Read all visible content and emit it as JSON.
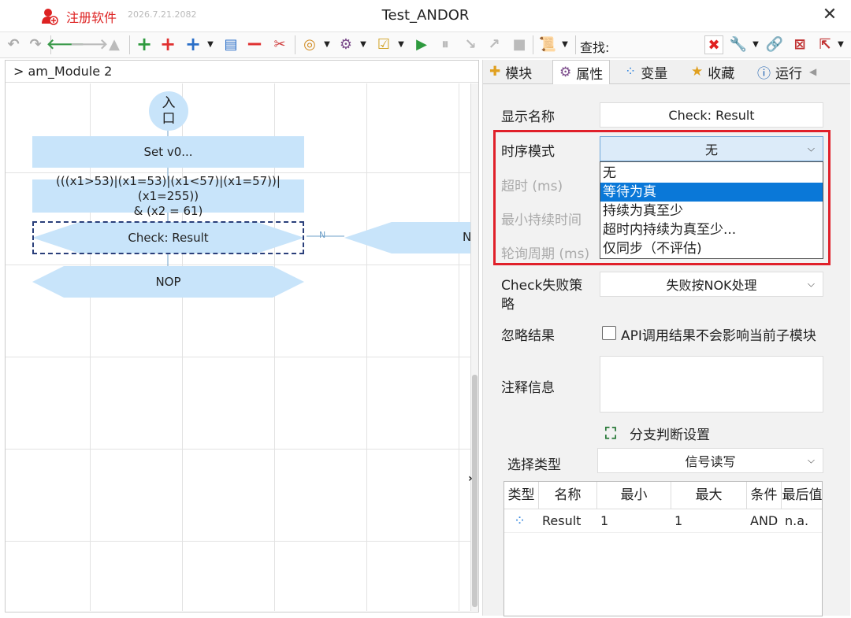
{
  "titlebar": {
    "reg_label": "注册软件",
    "reg_date": "2026.7.21.2082",
    "title": "Test_ANDOR",
    "close": "✕"
  },
  "toolbar": {
    "find_label": "查找:"
  },
  "left": {
    "breadcrumb": "> am_Module 2",
    "nodes": {
      "entry": "入\n口",
      "set": "Set v0...",
      "condition": "(((x1>53)|(x1=53)|(x1<57)|(x1=57))|(x1=255))\n& (x2 = 61)",
      "check": "Check: Result",
      "n_branch": "N",
      "n_label": "N",
      "nop": "NOP"
    }
  },
  "right": {
    "tabs": [
      "模块",
      "属性",
      "变量",
      "收藏",
      "运行"
    ],
    "display_name_label": "显示名称",
    "display_name_value": "Check: Result",
    "timing_label": "时序模式",
    "timing_value": "无",
    "timeout_label": "超时 (ms)",
    "min_duration_label": "最小持续时间",
    "poll_label": "轮询周期 (ms)",
    "timing_options": [
      "无",
      "等待为真",
      "持续为真至少",
      "超时内持续为真至少...",
      "仅同步（不评估)"
    ],
    "selected_option_index": 1,
    "fail_policy_label_1": "Check失败策",
    "fail_policy_label_2": "略",
    "fail_policy_value": "失败按NOK处理",
    "ignore_label": "忽略结果",
    "ignore_text": "API调用结果不会影响当前子模块",
    "comment_label": "注释信息",
    "branch_label": "分支判断设置",
    "select_type_label": "选择类型",
    "select_type_value": "信号读写",
    "table": {
      "headers": [
        "类型",
        "名称",
        "最小",
        "最大",
        "条件",
        "最后值"
      ],
      "rows": [
        {
          "name": "Result",
          "min": "1",
          "max": "1",
          "cond": "AND",
          "last": "n.a."
        }
      ]
    }
  }
}
